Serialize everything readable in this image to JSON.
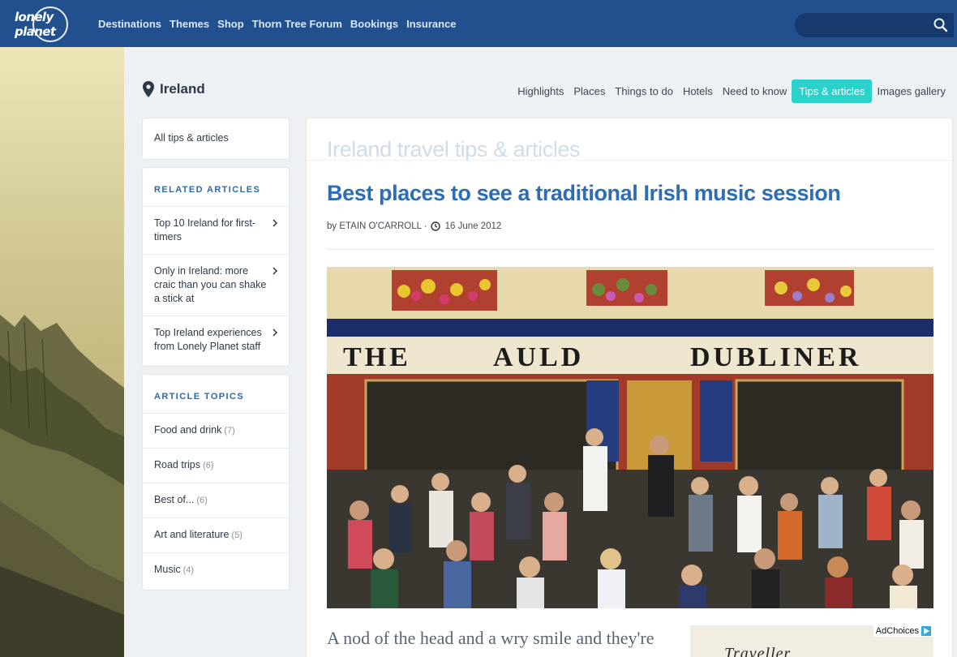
{
  "header": {
    "logo_text": "lonely planet",
    "nav": [
      "Destinations",
      "Themes",
      "Shop",
      "Thorn Tree Forum",
      "Bookings",
      "Insurance"
    ],
    "search_placeholder": "",
    "colors": {
      "bar": "#22508f",
      "accent": "#2bd1cb",
      "link": "#2d6db3"
    }
  },
  "location": {
    "icon": "map-pin-icon",
    "title": "Ireland"
  },
  "subnav": [
    {
      "label": "Highlights",
      "active": false
    },
    {
      "label": "Places",
      "active": false
    },
    {
      "label": "Things to do",
      "active": false
    },
    {
      "label": "Hotels",
      "active": false
    },
    {
      "label": "Need to know",
      "active": false
    },
    {
      "label": "Tips & articles",
      "active": true
    },
    {
      "label": "Images gallery",
      "active": false
    }
  ],
  "sidebar": {
    "all_tips": "All tips & articles",
    "related_heading": "RELATED ARTICLES",
    "related": [
      "Top 10 Ireland for first-timers",
      "Only in Ireland: more craic than you can shake a stick at",
      "Top Ireland experiences from Lonely Planet staff"
    ],
    "topics_heading": "ARTICLE TOPICS",
    "topics": [
      {
        "label": "Food and drink",
        "count": "(7)"
      },
      {
        "label": "Road trips",
        "count": "(6)"
      },
      {
        "label": "Best of...",
        "count": "(6)"
      },
      {
        "label": "Art and literature",
        "count": "(5)"
      },
      {
        "label": "Music",
        "count": "(4)"
      }
    ]
  },
  "article": {
    "section_title": "Ireland travel tips & articles",
    "title": "Best places to see a traditional Irish music session",
    "byline": "by ETAIN O'CARROLL ·",
    "date": "16 June 2012",
    "hero_sign": "THE AULD DUBLINER",
    "lead": "A nod of the head and a wry smile and they're"
  },
  "ad": {
    "choices": "AdChoices",
    "text": "Traveller"
  }
}
